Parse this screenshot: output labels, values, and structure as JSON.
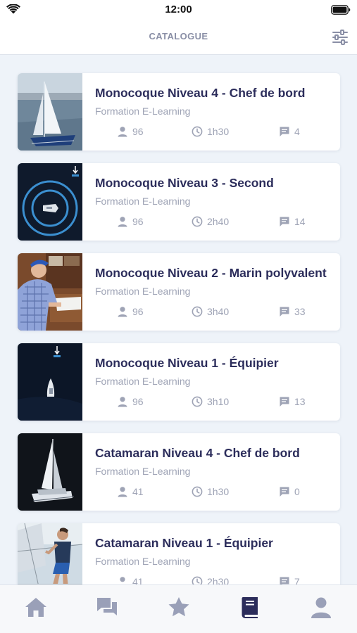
{
  "status_bar": {
    "time": "12:00"
  },
  "header": {
    "title": "CATALOGUE",
    "filter_icon": "sliders-icon"
  },
  "colors": {
    "title": "#2c2d5b",
    "meta": "#9ea3b5",
    "active_tab": "#2c2d5b",
    "inactive_tab": "#9aa0b8"
  },
  "courses": [
    {
      "title": "Monocoque Niveau 4 - Chef de bord",
      "subtitle": "Formation E-Learning",
      "users": "96",
      "duration": "1h30",
      "comments": "4",
      "image": "sailboat-photo"
    },
    {
      "title": "Monocoque Niveau 3 - Second",
      "subtitle": "Formation E-Learning",
      "users": "96",
      "duration": "2h40",
      "comments": "14",
      "image": "radar-boat-illustration"
    },
    {
      "title": "Monocoque Niveau 2 - Marin polyvalent",
      "subtitle": "Formation E-Learning",
      "users": "96",
      "duration": "3h40",
      "comments": "33",
      "image": "sailor-at-chart-table-photo"
    },
    {
      "title": "Monocoque Niveau 1 - Équipier",
      "subtitle": "Formation E-Learning",
      "users": "96",
      "duration": "3h10",
      "comments": "13",
      "image": "boat-top-view-illustration"
    },
    {
      "title": "Catamaran Niveau 4 - Chef de bord",
      "subtitle": "Formation E-Learning",
      "users": "41",
      "duration": "1h30",
      "comments": "0",
      "image": "catamaran-photo"
    },
    {
      "title": "Catamaran Niveau 1 - Équipier",
      "subtitle": "Formation E-Learning",
      "users": "41",
      "duration": "2h30",
      "comments": "7",
      "image": "sailor-on-deck-photo"
    }
  ],
  "tabs": [
    {
      "icon": "home-icon",
      "active": false
    },
    {
      "icon": "chat-icon",
      "active": false
    },
    {
      "icon": "star-icon",
      "active": false
    },
    {
      "icon": "book-icon",
      "active": true
    },
    {
      "icon": "user-icon",
      "active": false
    }
  ]
}
